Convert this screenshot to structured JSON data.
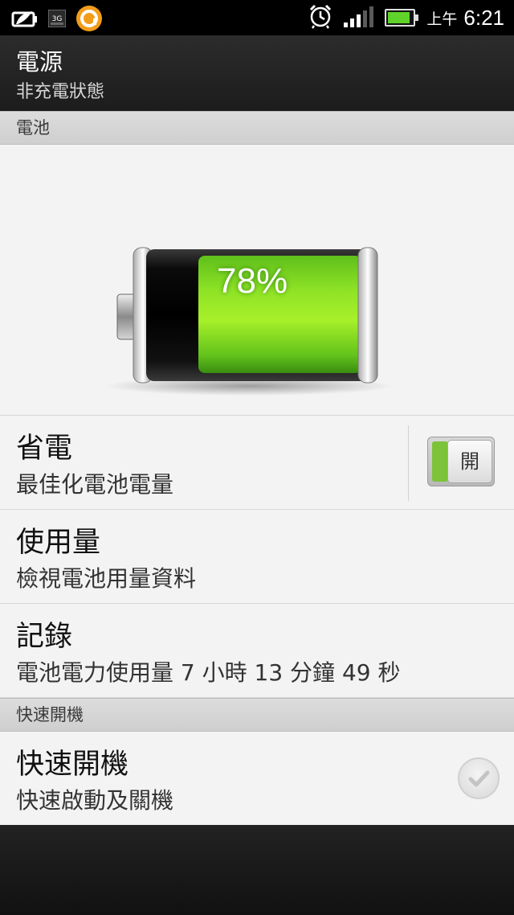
{
  "status_bar": {
    "icons_left": [
      "power-saver-icon",
      "3g-icon",
      "app-notification-icon"
    ],
    "icons_right": [
      "alarm-icon",
      "signal-icon",
      "battery-icon"
    ],
    "am_pm": "上午",
    "time": "6:21",
    "colors": {
      "battery_fill": "#5fd32a"
    }
  },
  "header": {
    "title": "電源",
    "subtitle": "非充電狀態"
  },
  "sections": {
    "battery": "電池",
    "fast_boot": "快速開機"
  },
  "battery": {
    "level_percent": 78,
    "label": "78%",
    "colors": {
      "fill": "#8be01f",
      "body": "#0d0d0d"
    }
  },
  "power_saver": {
    "title": "省電",
    "subtitle": "最佳化電池電量",
    "toggle_label": "開",
    "on": true
  },
  "usage": {
    "title": "使用量",
    "subtitle": "檢視電池用量資料"
  },
  "history": {
    "title": "記錄",
    "subtitle": "電池電力使用量 7 小時 13 分鐘 49 秒"
  },
  "fast_boot": {
    "title": "快速開機",
    "subtitle": "快速啟動及關機",
    "checked": false
  }
}
